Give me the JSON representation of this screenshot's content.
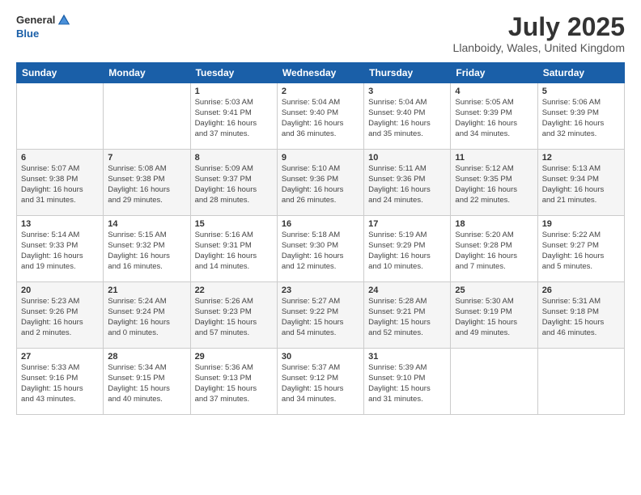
{
  "header": {
    "logo": {
      "line1": "General",
      "line2": "Blue"
    },
    "title": "July 2025",
    "location": "Llanboidy, Wales, United Kingdom"
  },
  "weekdays": [
    "Sunday",
    "Monday",
    "Tuesday",
    "Wednesday",
    "Thursday",
    "Friday",
    "Saturday"
  ],
  "weeks": [
    [
      {
        "day": "",
        "detail": ""
      },
      {
        "day": "",
        "detail": ""
      },
      {
        "day": "1",
        "detail": "Sunrise: 5:03 AM\nSunset: 9:41 PM\nDaylight: 16 hours\nand 37 minutes."
      },
      {
        "day": "2",
        "detail": "Sunrise: 5:04 AM\nSunset: 9:40 PM\nDaylight: 16 hours\nand 36 minutes."
      },
      {
        "day": "3",
        "detail": "Sunrise: 5:04 AM\nSunset: 9:40 PM\nDaylight: 16 hours\nand 35 minutes."
      },
      {
        "day": "4",
        "detail": "Sunrise: 5:05 AM\nSunset: 9:39 PM\nDaylight: 16 hours\nand 34 minutes."
      },
      {
        "day": "5",
        "detail": "Sunrise: 5:06 AM\nSunset: 9:39 PM\nDaylight: 16 hours\nand 32 minutes."
      }
    ],
    [
      {
        "day": "6",
        "detail": "Sunrise: 5:07 AM\nSunset: 9:38 PM\nDaylight: 16 hours\nand 31 minutes."
      },
      {
        "day": "7",
        "detail": "Sunrise: 5:08 AM\nSunset: 9:38 PM\nDaylight: 16 hours\nand 29 minutes."
      },
      {
        "day": "8",
        "detail": "Sunrise: 5:09 AM\nSunset: 9:37 PM\nDaylight: 16 hours\nand 28 minutes."
      },
      {
        "day": "9",
        "detail": "Sunrise: 5:10 AM\nSunset: 9:36 PM\nDaylight: 16 hours\nand 26 minutes."
      },
      {
        "day": "10",
        "detail": "Sunrise: 5:11 AM\nSunset: 9:36 PM\nDaylight: 16 hours\nand 24 minutes."
      },
      {
        "day": "11",
        "detail": "Sunrise: 5:12 AM\nSunset: 9:35 PM\nDaylight: 16 hours\nand 22 minutes."
      },
      {
        "day": "12",
        "detail": "Sunrise: 5:13 AM\nSunset: 9:34 PM\nDaylight: 16 hours\nand 21 minutes."
      }
    ],
    [
      {
        "day": "13",
        "detail": "Sunrise: 5:14 AM\nSunset: 9:33 PM\nDaylight: 16 hours\nand 19 minutes."
      },
      {
        "day": "14",
        "detail": "Sunrise: 5:15 AM\nSunset: 9:32 PM\nDaylight: 16 hours\nand 16 minutes."
      },
      {
        "day": "15",
        "detail": "Sunrise: 5:16 AM\nSunset: 9:31 PM\nDaylight: 16 hours\nand 14 minutes."
      },
      {
        "day": "16",
        "detail": "Sunrise: 5:18 AM\nSunset: 9:30 PM\nDaylight: 16 hours\nand 12 minutes."
      },
      {
        "day": "17",
        "detail": "Sunrise: 5:19 AM\nSunset: 9:29 PM\nDaylight: 16 hours\nand 10 minutes."
      },
      {
        "day": "18",
        "detail": "Sunrise: 5:20 AM\nSunset: 9:28 PM\nDaylight: 16 hours\nand 7 minutes."
      },
      {
        "day": "19",
        "detail": "Sunrise: 5:22 AM\nSunset: 9:27 PM\nDaylight: 16 hours\nand 5 minutes."
      }
    ],
    [
      {
        "day": "20",
        "detail": "Sunrise: 5:23 AM\nSunset: 9:26 PM\nDaylight: 16 hours\nand 2 minutes."
      },
      {
        "day": "21",
        "detail": "Sunrise: 5:24 AM\nSunset: 9:24 PM\nDaylight: 16 hours\nand 0 minutes."
      },
      {
        "day": "22",
        "detail": "Sunrise: 5:26 AM\nSunset: 9:23 PM\nDaylight: 15 hours\nand 57 minutes."
      },
      {
        "day": "23",
        "detail": "Sunrise: 5:27 AM\nSunset: 9:22 PM\nDaylight: 15 hours\nand 54 minutes."
      },
      {
        "day": "24",
        "detail": "Sunrise: 5:28 AM\nSunset: 9:21 PM\nDaylight: 15 hours\nand 52 minutes."
      },
      {
        "day": "25",
        "detail": "Sunrise: 5:30 AM\nSunset: 9:19 PM\nDaylight: 15 hours\nand 49 minutes."
      },
      {
        "day": "26",
        "detail": "Sunrise: 5:31 AM\nSunset: 9:18 PM\nDaylight: 15 hours\nand 46 minutes."
      }
    ],
    [
      {
        "day": "27",
        "detail": "Sunrise: 5:33 AM\nSunset: 9:16 PM\nDaylight: 15 hours\nand 43 minutes."
      },
      {
        "day": "28",
        "detail": "Sunrise: 5:34 AM\nSunset: 9:15 PM\nDaylight: 15 hours\nand 40 minutes."
      },
      {
        "day": "29",
        "detail": "Sunrise: 5:36 AM\nSunset: 9:13 PM\nDaylight: 15 hours\nand 37 minutes."
      },
      {
        "day": "30",
        "detail": "Sunrise: 5:37 AM\nSunset: 9:12 PM\nDaylight: 15 hours\nand 34 minutes."
      },
      {
        "day": "31",
        "detail": "Sunrise: 5:39 AM\nSunset: 9:10 PM\nDaylight: 15 hours\nand 31 minutes."
      },
      {
        "day": "",
        "detail": ""
      },
      {
        "day": "",
        "detail": ""
      }
    ]
  ]
}
